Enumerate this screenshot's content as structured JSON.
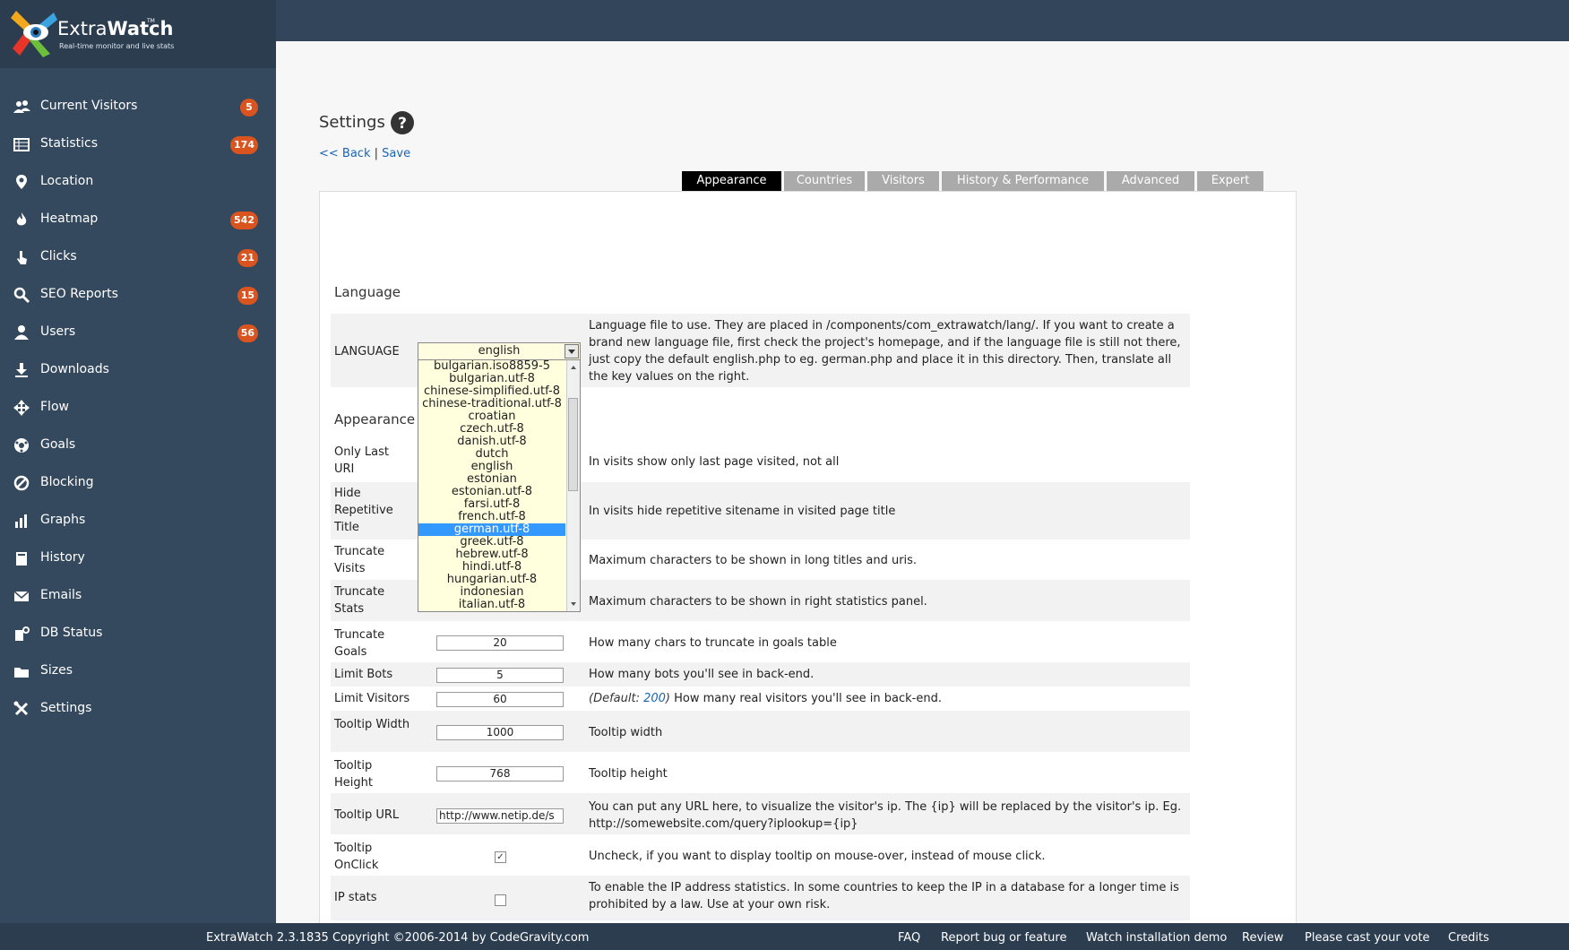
{
  "app": {
    "name_light": "Extra",
    "name_bold": "Watch",
    "tagline": "Real-time monitor and live stats",
    "tm": "TM"
  },
  "sidebar": {
    "items": [
      {
        "label": "Current Visitors",
        "badge": "5",
        "icon": "visitors-icon"
      },
      {
        "label": "Statistics",
        "badge": "174",
        "icon": "statistics-icon"
      },
      {
        "label": "Location",
        "badge": "",
        "icon": "location-icon"
      },
      {
        "label": "Heatmap",
        "badge": "542",
        "icon": "heatmap-icon"
      },
      {
        "label": "Clicks",
        "badge": "21",
        "icon": "clicks-icon"
      },
      {
        "label": "SEO Reports",
        "badge": "15",
        "icon": "search-icon"
      },
      {
        "label": "Users",
        "badge": "56",
        "icon": "user-icon"
      },
      {
        "label": "Downloads",
        "badge": "",
        "icon": "download-icon"
      },
      {
        "label": "Flow",
        "badge": "",
        "icon": "flow-icon"
      },
      {
        "label": "Goals",
        "badge": "",
        "icon": "goals-icon"
      },
      {
        "label": "Blocking",
        "badge": "",
        "icon": "blocking-icon"
      },
      {
        "label": "Graphs",
        "badge": "",
        "icon": "graph-icon"
      },
      {
        "label": "History",
        "badge": "",
        "icon": "history-icon"
      },
      {
        "label": "Emails",
        "badge": "",
        "icon": "email-icon"
      },
      {
        "label": "DB Status",
        "badge": "",
        "icon": "db-status-icon"
      },
      {
        "label": "Sizes",
        "badge": "",
        "icon": "folder-icon"
      },
      {
        "label": "Settings",
        "badge": "",
        "icon": "settings-icon"
      }
    ]
  },
  "page": {
    "title": "Settings",
    "back": "<< Back",
    "sep": "|",
    "save": "Save"
  },
  "tabs": [
    {
      "label": "Appearance",
      "active": true
    },
    {
      "label": "Countries",
      "active": false
    },
    {
      "label": "Visitors",
      "active": false
    },
    {
      "label": "History & Performance",
      "active": false
    },
    {
      "label": "Advanced",
      "active": false
    },
    {
      "label": "Expert",
      "active": false
    }
  ],
  "language_section": {
    "heading": "Language",
    "label": "LANGUAGE",
    "selected": "english",
    "desc": "Language file to use. They are placed in /components/com_extrawatch/lang/. If you want to create a brand new language file, first check the project's homepage, and if the language file is still not there, just copy the default english.php to eg. german.php and place it in this directory. Then, translate all the key values on the right.",
    "options": [
      "bulgarian.iso8859-5",
      "bulgarian.utf-8",
      "chinese-simplified.utf-8",
      "chinese-traditional.utf-8",
      "croatian",
      "czech.utf-8",
      "danish.utf-8",
      "dutch",
      "english",
      "estonian",
      "estonian.utf-8",
      "farsi.utf-8",
      "french.utf-8",
      "german.utf-8",
      "greek.utf-8",
      "hebrew.utf-8",
      "hindi.utf-8",
      "hungarian.utf-8",
      "indonesian",
      "italian.utf-8"
    ],
    "highlighted": "german.utf-8"
  },
  "appearance_section": {
    "heading": "Appearance",
    "rows": [
      {
        "label": "Only Last URI",
        "desc": "In visits show only last page visited, not all"
      },
      {
        "label": "Hide Repetitive Title",
        "desc": "In visits hide repetitive sitename in visited page title"
      },
      {
        "label": "Truncate Visits",
        "desc": "Maximum characters to be shown in long titles and uris."
      },
      {
        "label": "Truncate Stats",
        "desc": "Maximum characters to be shown in right statistics panel."
      },
      {
        "label": "Truncate Goals",
        "value": "20",
        "desc": "How many chars to truncate in goals table"
      },
      {
        "label": "Limit Bots",
        "value": "5",
        "desc": "How many bots you'll see in back-end."
      },
      {
        "label": "Limit Visitors",
        "value": "60",
        "default_prefix": "(Default: ",
        "default_value": "200",
        "default_suffix": ")",
        "desc": "How many real visitors you'll see in back-end."
      },
      {
        "label": "Tooltip Width",
        "value": "1000",
        "desc": "Tooltip width"
      },
      {
        "label": "Tooltip Height",
        "value": "768",
        "desc": "Tooltip height"
      },
      {
        "label": "Tooltip URL",
        "value": "http://www.netip.de/s",
        "desc": "You can put any URL here, to visualize the visitor's ip. The {ip} will be replaced by the visitor's ip. Eg. http://somewebsite.com/query?iplookup={ip}"
      },
      {
        "label": "Tooltip OnClick",
        "checked": true,
        "desc": "Uncheck, if you want to display tooltip on mouse-over, instead of mouse click."
      },
      {
        "label": "IP stats",
        "checked": false,
        "desc": "To enable the IP address statistics. In some countries to keep the IP in a database for a longer time is prohibited by a law. Use at your own risk."
      }
    ]
  },
  "footer": {
    "copyright": "ExtraWatch 2.3.1835 Copyright ©2006-2014 by CodeGravity.com",
    "links": [
      "FAQ",
      "Report bug or feature",
      "Watch installation demo",
      "Review",
      "Please cast your vote",
      "Credits"
    ]
  },
  "colors": {
    "sidebar": "#34485e",
    "badge": "#d9541e",
    "active_tab": "#000000",
    "tab": "#aaaaaa",
    "link": "#1a66b5"
  }
}
